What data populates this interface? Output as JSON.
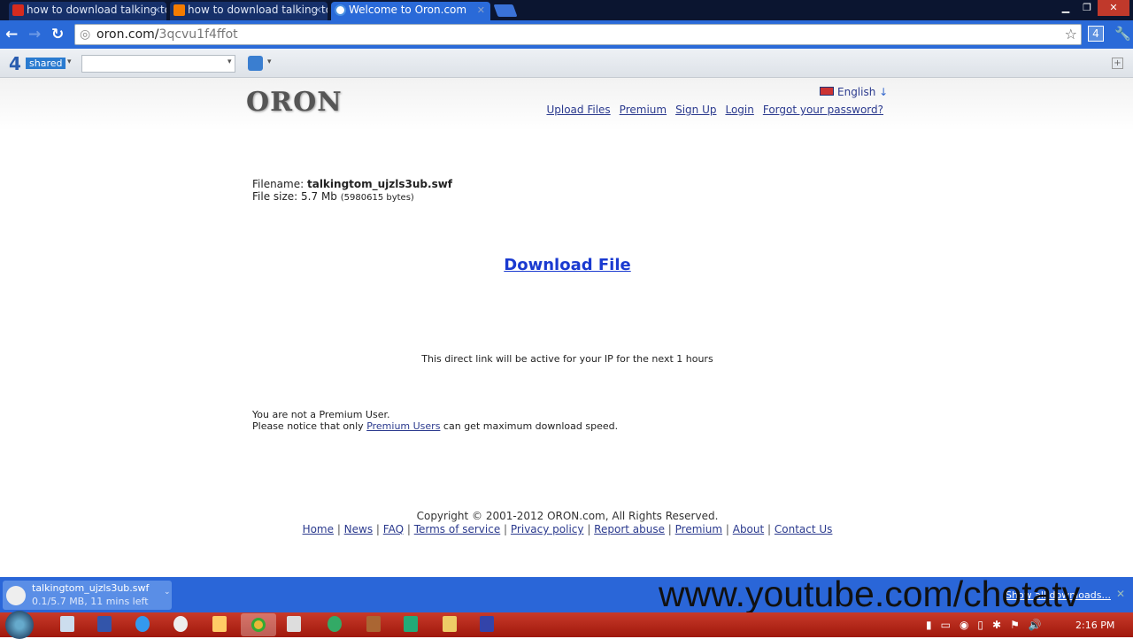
{
  "browser": {
    "tabs": [
      {
        "title": "how to download talking to",
        "icon_color": "#d62b1e"
      },
      {
        "title": "how to download talking to",
        "icon_color": "#f57c00"
      },
      {
        "title": "Welcome to Oron.com",
        "icon_color": "#4a90e2"
      }
    ],
    "url_host": "oron.com/",
    "url_path": "3qcvu1f4ffot",
    "bookmarks": {
      "fourshared_num": "4",
      "fourshared_label": "shared",
      "search_value": ""
    }
  },
  "site": {
    "logo": "ORON",
    "language": "English",
    "nav": [
      "Upload Files",
      "Premium",
      "Sign Up",
      "Login",
      "Forgot your password?"
    ],
    "filename_label": "Filename:",
    "filename": "talkingtom_ujzls3ub.swf",
    "filesize_label": "File size:",
    "filesize": "5.7 Mb",
    "filesize_bytes": "(5980615 bytes)",
    "download_link": "Download File",
    "direct_link_note": "This direct link will be active for your IP for the next 1 hours",
    "premium_note1": "You are not a Premium User.",
    "premium_note2_pre": "Please notice that only ",
    "premium_note2_link": "Premium Users",
    "premium_note2_post": " can get maximum download speed.",
    "copyright": "Copyright © 2001-2012 ORON.com, All Rights Reserved.",
    "footer_links": [
      "Home",
      "News",
      "FAQ",
      "Terms of service",
      "Privacy policy",
      "Report abuse",
      "Premium",
      "About",
      "Contact Us"
    ]
  },
  "download_shelf": {
    "filename": "talkingtom_ujzls3ub.swf",
    "progress": "0.1/5.7 MB, 11 mins left",
    "progress_fraction": 0.0175,
    "show_all": "Show all downloads..."
  },
  "watermark": "www.youtube.com/chotatv",
  "taskbar": {
    "time": "2:16 PM"
  }
}
